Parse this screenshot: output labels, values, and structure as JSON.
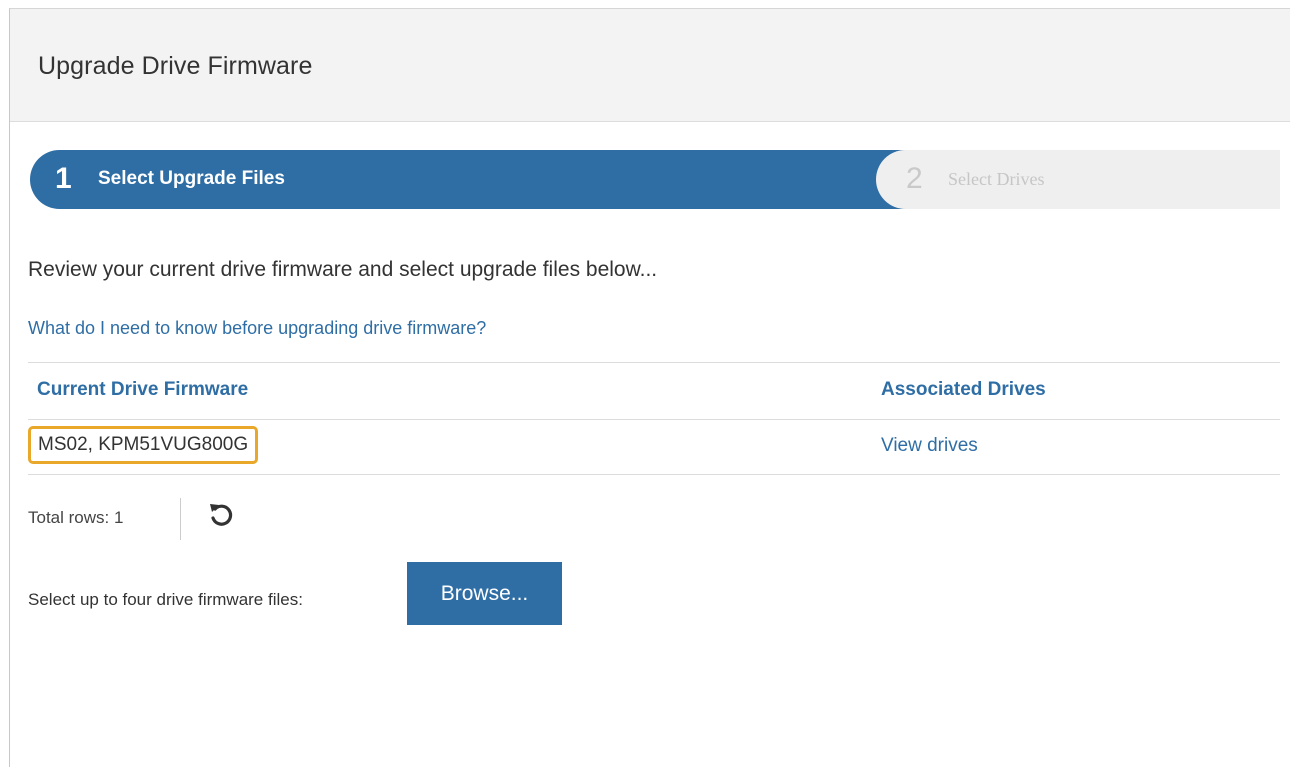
{
  "dialog": {
    "title": "Upgrade Drive Firmware"
  },
  "wizard": {
    "steps": [
      {
        "number": "1",
        "label": "Select Upgrade Files",
        "state": "active"
      },
      {
        "number": "2",
        "label": "Select Drives",
        "state": "inactive"
      }
    ]
  },
  "content": {
    "intro": "Review your current drive firmware and select upgrade files below...",
    "help_link": "What do I need to know before upgrading drive firmware?"
  },
  "table": {
    "columns": [
      "Current Drive Firmware",
      "Associated Drives"
    ],
    "rows": [
      {
        "firmware": "MS02, KPM51VUG800G",
        "drives_link": "View drives"
      }
    ],
    "total_rows_label": "Total rows: 1",
    "refresh_icon": "refresh-icon"
  },
  "upload": {
    "label": "Select up to four drive firmware files:",
    "browse_label": "Browse..."
  },
  "colors": {
    "accent": "#2f6ea5",
    "highlight_border": "#eaa82a",
    "header_bg": "#f3f3f3"
  }
}
